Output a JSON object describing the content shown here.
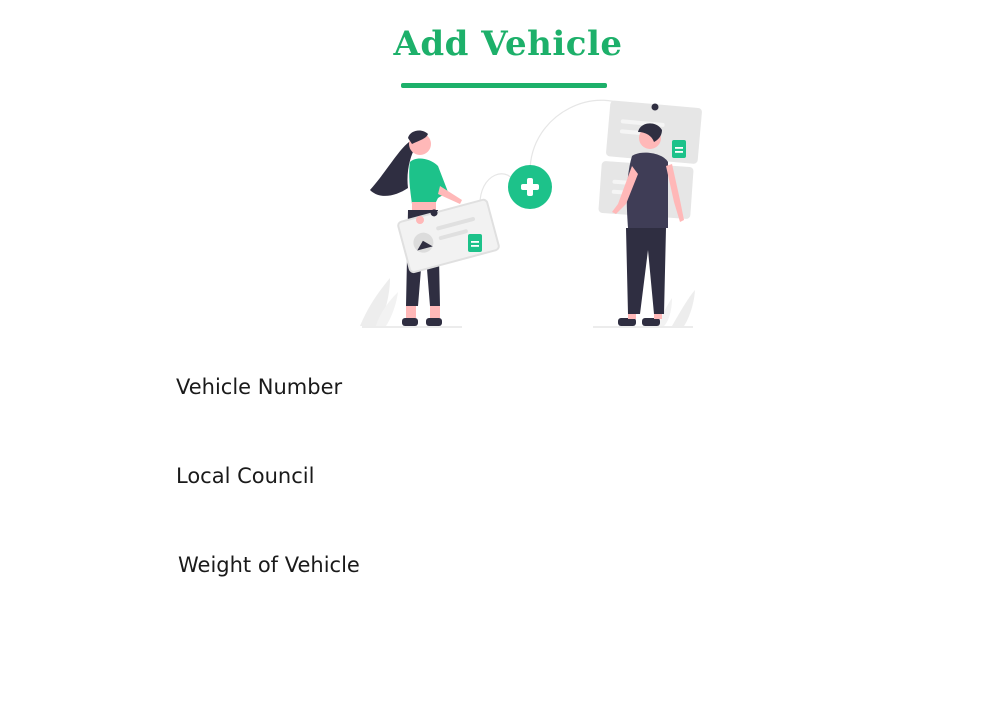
{
  "page": {
    "title": "Add Vehicle"
  },
  "colors": {
    "accent": "#1db06a",
    "illustration_green": "#1dc28a",
    "illustration_dark": "#2f2e41",
    "illustration_gray": "#e6e6e6"
  },
  "form": {
    "fields": [
      {
        "label": "Vehicle Number"
      },
      {
        "label": "Local Council"
      },
      {
        "label": "Weight of Vehicle"
      }
    ]
  }
}
